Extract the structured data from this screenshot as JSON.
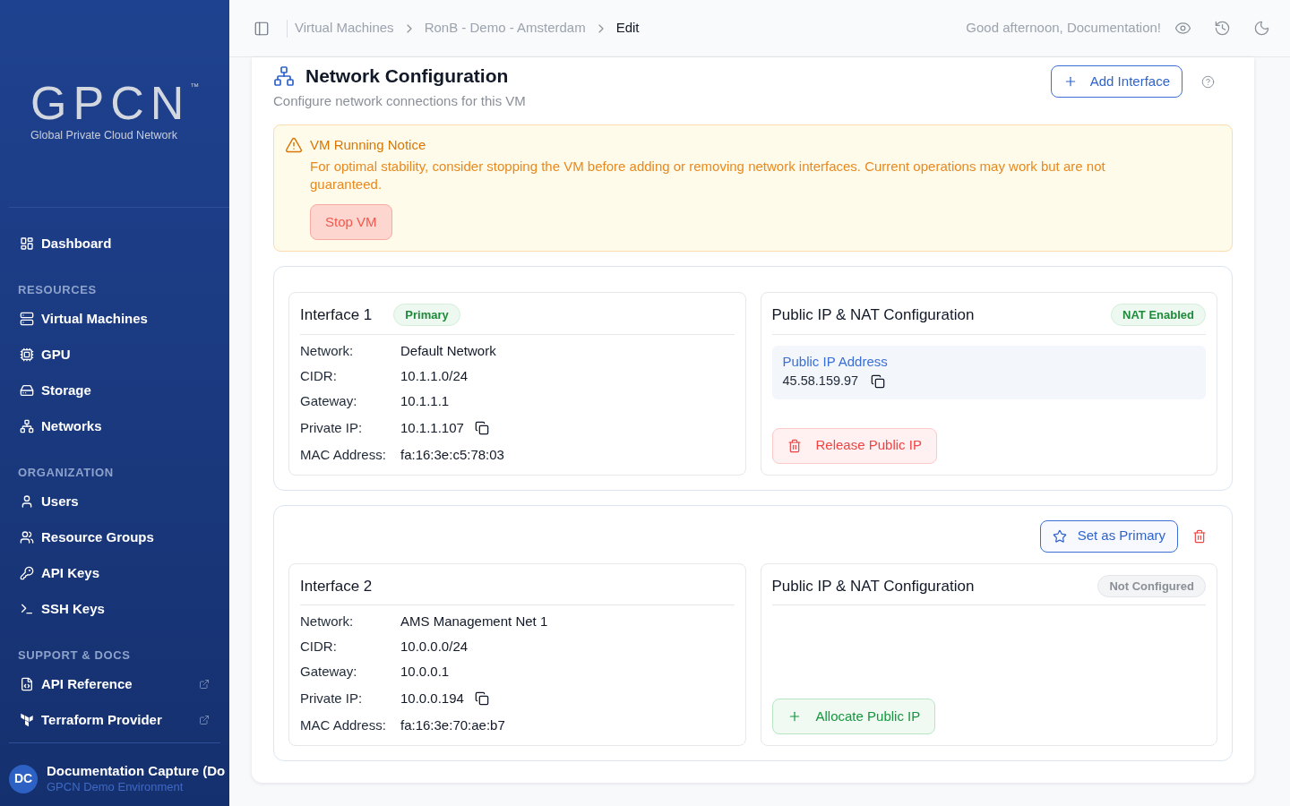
{
  "sidebar": {
    "logo": {
      "wordmark": "GPCN",
      "trademark": "™",
      "tagline": "Global Private Cloud Network"
    },
    "sections": [
      {
        "items": [
          {
            "label": "Dashboard",
            "external": false
          }
        ]
      },
      {
        "heading": "RESOURCES",
        "items": [
          {
            "label": "Virtual Machines",
            "external": false
          },
          {
            "label": "GPU",
            "external": false
          },
          {
            "label": "Storage",
            "external": false
          },
          {
            "label": "Networks",
            "external": false
          }
        ]
      },
      {
        "heading": "ORGANIZATION",
        "items": [
          {
            "label": "Users",
            "external": false
          },
          {
            "label": "Resource Groups",
            "external": false
          },
          {
            "label": "API Keys",
            "external": false
          },
          {
            "label": "SSH Keys",
            "external": false
          }
        ]
      },
      {
        "heading": "SUPPORT & DOCS",
        "items": [
          {
            "label": "API Reference",
            "external": true
          },
          {
            "label": "Terraform Provider",
            "external": true
          }
        ]
      }
    ],
    "user": {
      "initials": "DC",
      "name": "Documentation Capture (Do",
      "subtitle": "GPCN Demo Environment"
    }
  },
  "topbar": {
    "breadcrumb": [
      {
        "label": "Virtual Machines",
        "current": false
      },
      {
        "label": "RonB - Demo - Amsterdam",
        "current": false
      },
      {
        "label": "Edit",
        "current": true
      }
    ],
    "greeting": "Good afternoon, Documentation!"
  },
  "network_configuration": {
    "title": "Network Configuration",
    "subtitle": "Configure network connections for this VM",
    "add_button": "Add Interface",
    "notice": {
      "title": "VM Running Notice",
      "message": "For optimal stability, consider stopping the VM before adding or removing network interfaces. Current operations may work but are not guaranteed.",
      "button": "Stop VM"
    },
    "interfaces": [
      {
        "title": "Interface 1",
        "badge": "Primary",
        "deletable": false,
        "details": [
          {
            "label": "Network:",
            "value": "Default Network",
            "copyable": false
          },
          {
            "label": "CIDR:",
            "value": "10.1.1.0/24",
            "copyable": false
          },
          {
            "label": "Gateway:",
            "value": "10.1.1.1",
            "copyable": false
          },
          {
            "label": "Private IP:",
            "value": "10.1.1.107",
            "copyable": true
          },
          {
            "label": "MAC Address:",
            "value": "fa:16:3e:c5:78:03",
            "copyable": false
          }
        ],
        "public_ip": {
          "title": "Public IP & NAT Configuration",
          "status": {
            "label": "NAT Enabled",
            "kind": "enabled"
          },
          "address_label": "Public IP Address",
          "address": "45.58.159.97",
          "action": {
            "label": "Release Public IP",
            "kind": "release"
          }
        }
      },
      {
        "title": "Interface 2",
        "set_primary_button": "Set as Primary",
        "deletable": true,
        "details": [
          {
            "label": "Network:",
            "value": "AMS Management Net 1",
            "copyable": false
          },
          {
            "label": "CIDR:",
            "value": "10.0.0.0/24",
            "copyable": false
          },
          {
            "label": "Gateway:",
            "value": "10.0.0.1",
            "copyable": false
          },
          {
            "label": "Private IP:",
            "value": "10.0.0.194",
            "copyable": true
          },
          {
            "label": "MAC Address:",
            "value": "fa:16:3e:70:ae:b7",
            "copyable": false
          }
        ],
        "public_ip": {
          "title": "Public IP & NAT Configuration",
          "status": {
            "label": "Not Configured",
            "kind": "not_configured"
          },
          "action": {
            "label": "Allocate Public IP",
            "kind": "allocate"
          }
        }
      }
    ]
  }
}
